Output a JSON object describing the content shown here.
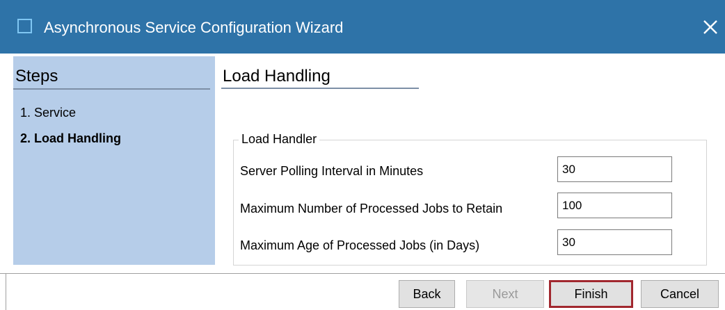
{
  "window": {
    "title": "Asynchronous Service Configuration Wizard",
    "close_glyph": "✕",
    "accent_color": "#2e73a8"
  },
  "steps": {
    "header": "Steps",
    "items": [
      {
        "label": "1. Service",
        "active": false
      },
      {
        "label": "2. Load Handling",
        "active": true
      }
    ],
    "panel_color": "#b6cde9"
  },
  "content": {
    "title": "Load Handling",
    "group_label": "Load Handler",
    "fields": [
      {
        "label": "Server Polling Interval in Minutes",
        "value": "30"
      },
      {
        "label": "Maximum Number of Processed Jobs to Retain",
        "value": "100"
      },
      {
        "label": "Maximum Age of Processed Jobs (in Days)",
        "value": "30"
      }
    ]
  },
  "buttons": {
    "back": "Back",
    "next": "Next",
    "finish": "Finish",
    "cancel": "Cancel",
    "focus_color": "#a1272e"
  }
}
